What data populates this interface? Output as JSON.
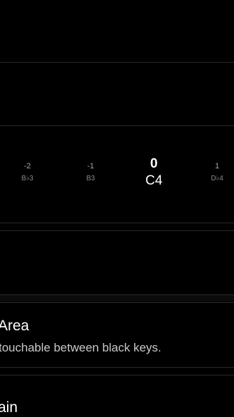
{
  "transpose_picker": {
    "items": [
      {
        "offset": "-2",
        "note": "B♭3"
      },
      {
        "offset": "-1",
        "note": "B3"
      },
      {
        "offset": "0",
        "note": "C4"
      },
      {
        "offset": "1",
        "note": "D♭4"
      }
    ]
  },
  "settings": {
    "touch_area": {
      "title": "Area",
      "description": " touchable between black keys."
    },
    "gain": {
      "title": "ain"
    }
  }
}
